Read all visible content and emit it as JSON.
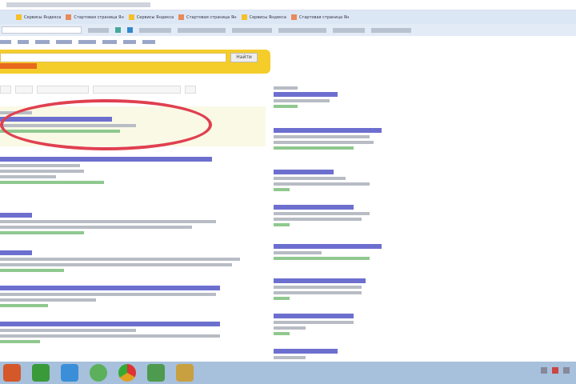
{
  "bookmarks": [
    {
      "label": "Сервисы Яндекса"
    },
    {
      "label": "Стартовая страница Ян"
    },
    {
      "label": "Сервисы Яндекса"
    },
    {
      "label": "Стартовая страница Ян"
    },
    {
      "label": "Сервисы Яндекса"
    },
    {
      "label": "Стартовая страница Ян"
    }
  ],
  "search": {
    "query": "",
    "button": "Найти"
  },
  "taskbar": {
    "apps": [
      "firefox",
      "browser",
      "skype",
      "chat",
      "chrome",
      "excel",
      "paint"
    ],
    "colors": [
      "#d4582a",
      "#3a9a3a",
      "#3a8fd8",
      "#5cb05c",
      "#e0a020",
      "#4e9a4e",
      "#c8a040"
    ]
  },
  "annotation_color": "#e04050",
  "accent": "#f5cd2a"
}
